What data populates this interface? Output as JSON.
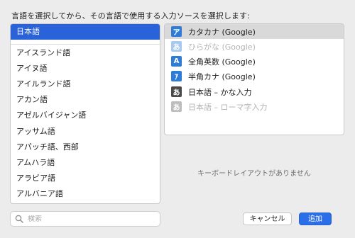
{
  "prompt": "言語を選択してから、その言語で使用する入力ソースを選択します:",
  "languages": {
    "selected": "日本語",
    "items": [
      "アイスランド語",
      "アイヌ語",
      "アイルランド語",
      "アカン語",
      "アゼルバイジャン語",
      "アッサム語",
      "アパッチ語、西部",
      "アムハラ語",
      "アラビア語",
      "アルバニア語"
    ]
  },
  "input_sources": [
    {
      "icon_glyph": "ア",
      "icon_name": "katakana-icon",
      "label": "カタカナ (Google)",
      "selected": true,
      "enabled": true
    },
    {
      "icon_glyph": "あ",
      "icon_name": "hiragana-icon",
      "label": "ひらがな (Google)",
      "selected": false,
      "enabled": false
    },
    {
      "icon_glyph": "A",
      "icon_name": "fullwidth-roman-icon",
      "label": "全角英数 (Google)",
      "selected": false,
      "enabled": true
    },
    {
      "icon_glyph": "ｱ",
      "icon_name": "halfwidth-katakana-icon",
      "label": "半角カナ (Google)",
      "selected": false,
      "enabled": true
    },
    {
      "icon_glyph": "あ",
      "icon_name": "kana-input-icon",
      "label": "日本語 – かな入力",
      "selected": false,
      "enabled": true
    },
    {
      "icon_glyph": "あ",
      "icon_name": "romaji-input-icon",
      "label": "日本語 – ローマ字入力",
      "selected": false,
      "enabled": false
    }
  ],
  "no_layout_text": "キーボードレイアウトがありません",
  "search": {
    "placeholder": "検索",
    "value": ""
  },
  "buttons": {
    "cancel": "キャンセル",
    "add": "追加"
  },
  "colors": {
    "accent": "#2962d9",
    "add_button": "#2a6ee8"
  }
}
